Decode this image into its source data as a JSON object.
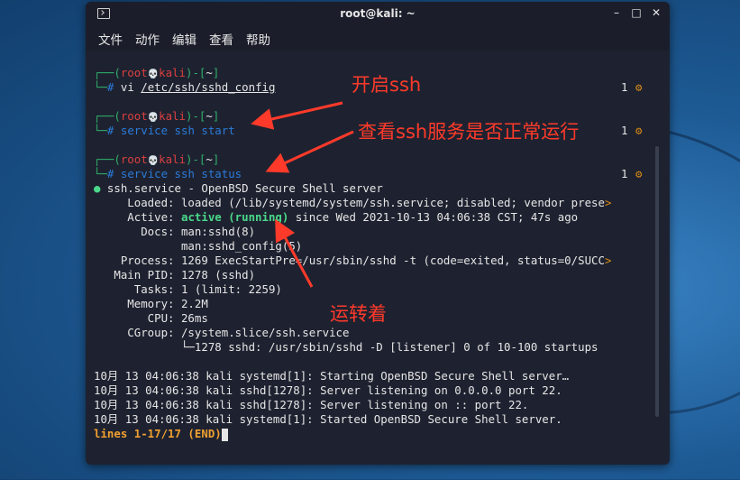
{
  "window": {
    "title": "root@kali: ~",
    "minimize_glyph": "–",
    "maximize_glyph": "□",
    "close_glyph": "✕"
  },
  "menu": {
    "items": [
      "文件",
      "动作",
      "编辑",
      "查看",
      "帮助"
    ]
  },
  "prompt": {
    "open": "┌──(",
    "user": "root",
    "skull": "💀",
    "host": "kali",
    "mid": ")-[",
    "dir": "~",
    "close": "]",
    "second": "└─",
    "hash": "#"
  },
  "commands": {
    "cmd1_pre": "vi ",
    "cmd1_path": "/etc/ssh/sshd_config",
    "cmd2": "service ssh start",
    "cmd3": "service ssh status",
    "count": "1",
    "gear": "⚙"
  },
  "status": {
    "l1_dot": "●",
    "l1": " ssh.service - OpenBSD Secure Shell server",
    "l2": "     Loaded: loaded (/lib/systemd/system/ssh.service; disabled; vendor prese",
    "l2_trunc": ">",
    "l3_pre": "     Active: ",
    "l3_active": "active (running)",
    "l3_post": " since Wed 2021-10-13 04:06:38 CST; 47s ago",
    "l4": "       Docs: man:sshd(8)",
    "l5": "             man:sshd_config(5)",
    "l6": "    Process: 1269 ExecStartPre=/usr/sbin/sshd -t (code=exited, status=0/SUCC",
    "l6_trunc": ">",
    "l7": "   Main PID: 1278 (sshd)",
    "l8": "      Tasks: 1 (limit: 2259)",
    "l9": "     Memory: 2.2M",
    "l10": "        CPU: 26ms",
    "l11": "     CGroup: /system.slice/ssh.service",
    "l12": "             └─1278 sshd: /usr/sbin/sshd -D [listener] 0 of 10-100 startups"
  },
  "log": [
    "10月 13 04:06:38 kali systemd[1]: Starting OpenBSD Secure Shell server…",
    "10月 13 04:06:38 kali sshd[1278]: Server listening on 0.0.0.0 port 22.",
    "10月 13 04:06:38 kali sshd[1278]: Server listening on :: port 22.",
    "10月 13 04:06:38 kali systemd[1]: Started OpenBSD Secure Shell server."
  ],
  "pager": "lines 1-17/17 (END)",
  "annotations": {
    "a1": "开启ssh",
    "a2": "查看ssh服务是否正常运行",
    "a3": "运转着"
  },
  "colors": {
    "annotation_red": "#ff3a2a",
    "prompt_blue": "#2b7bd9",
    "prompt_red": "#d94040",
    "active_green": "#4ad98a",
    "pager_orange": "#f0a030"
  }
}
